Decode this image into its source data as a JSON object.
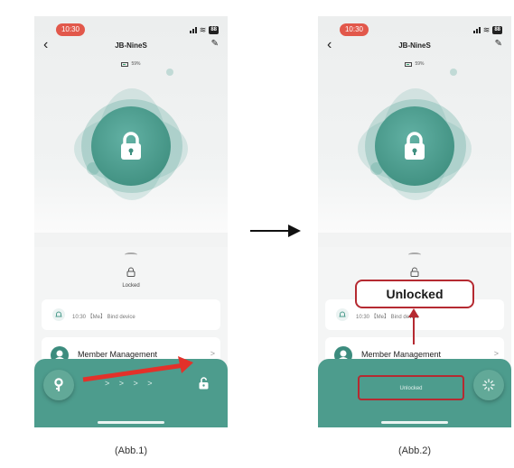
{
  "screens": [
    {
      "status_time": "10:30",
      "battery_badge": "88",
      "device_title": "JB-NineS",
      "battery_percent": "59%",
      "lock_status": "Locked",
      "record_text": "10:30 【Me】 Bind device",
      "member_label": "Member Management",
      "chevron": ">",
      "slide_arrows": "> > > >",
      "caption": "(Abb.1)"
    },
    {
      "status_time": "10:30",
      "battery_badge": "88",
      "device_title": "JB-NineS",
      "battery_percent": "59%",
      "record_text": "10:30 【Me】 Bind device",
      "member_label": "Member Management",
      "chevron": ">",
      "bar_status": "Unlocked",
      "callout": "Unlocked",
      "caption": "(Abb.2)"
    }
  ],
  "colors": {
    "accent": "#4d9c8d",
    "time_pill": "#e2584b",
    "highlight": "#b52a31",
    "swipe_arrow": "#e3312a"
  }
}
